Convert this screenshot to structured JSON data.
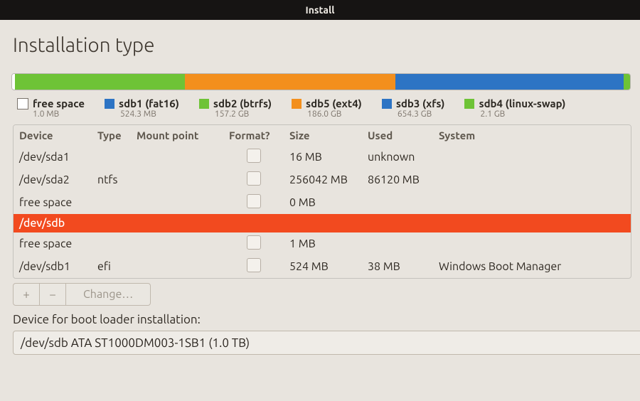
{
  "window": {
    "title": "Install"
  },
  "page": {
    "heading": "Installation type"
  },
  "partition_bar": {
    "segments": [
      {
        "name": "free",
        "color": "#ffffff",
        "pct": 0.5,
        "outline": true
      },
      {
        "name": "sdb1",
        "color": "#6ec336",
        "pct": 27
      },
      {
        "name": "sdb2",
        "color": "#6ec336",
        "pct": 0.5
      },
      {
        "name": "sdb5",
        "color": "#f38f1d",
        "pct": 34
      },
      {
        "name": "sdb3",
        "color": "#2d74c4",
        "pct": 37
      },
      {
        "name": "sdb4",
        "color": "#6ec336",
        "pct": 1
      }
    ]
  },
  "legend": [
    {
      "swatch": "#ffffff",
      "empty": true,
      "label": "free space",
      "sub": "1.0 MB"
    },
    {
      "swatch": "#2d74c4",
      "empty": false,
      "label": "sdb1 (fat16)",
      "sub": "524.3 MB"
    },
    {
      "swatch": "#6ec336",
      "empty": false,
      "label": "sdb2 (btrfs)",
      "sub": "157.2 GB"
    },
    {
      "swatch": "#f38f1d",
      "empty": false,
      "label": "sdb5 (ext4)",
      "sub": "186.0 GB"
    },
    {
      "swatch": "#2d74c4",
      "empty": false,
      "label": "sdb3 (xfs)",
      "sub": "654.3 GB"
    },
    {
      "swatch": "#6ec336",
      "empty": false,
      "label": "sdb4 (linux-swap)",
      "sub": "2.1 GB"
    }
  ],
  "table": {
    "columns": [
      "Device",
      "Type",
      "Mount point",
      "Format?",
      "Size",
      "Used",
      "System"
    ],
    "rows": [
      {
        "device": "/dev/sda1",
        "type": "",
        "mount": "",
        "format": "check",
        "size": "16 MB",
        "used": "unknown",
        "system": "",
        "selected": false
      },
      {
        "device": "/dev/sda2",
        "type": "ntfs",
        "mount": "",
        "format": "check",
        "size": "256042 MB",
        "used": "86120 MB",
        "system": "",
        "selected": false
      },
      {
        "device": "free space",
        "type": "",
        "mount": "",
        "format": "check",
        "size": "0 MB",
        "used": "",
        "system": "",
        "selected": false
      },
      {
        "device": "/dev/sdb",
        "type": "",
        "mount": "",
        "format": "",
        "size": "",
        "used": "",
        "system": "",
        "selected": true
      },
      {
        "device": "free space",
        "type": "",
        "mount": "",
        "format": "check",
        "size": "1 MB",
        "used": "",
        "system": "",
        "selected": false
      },
      {
        "device": "/dev/sdb1",
        "type": "efi",
        "mount": "",
        "format": "check",
        "size": "524 MB",
        "used": "38 MB",
        "system": "Windows Boot Manager",
        "selected": false
      }
    ]
  },
  "actions": {
    "add": "+",
    "remove": "−",
    "change": "Change…"
  },
  "bootloader": {
    "label": "Device for boot loader installation:",
    "value": "/dev/sdb    ATA ST1000DM003-1SB1 (1.0 TB)"
  },
  "colors": {
    "accent": "#f24a1f"
  }
}
